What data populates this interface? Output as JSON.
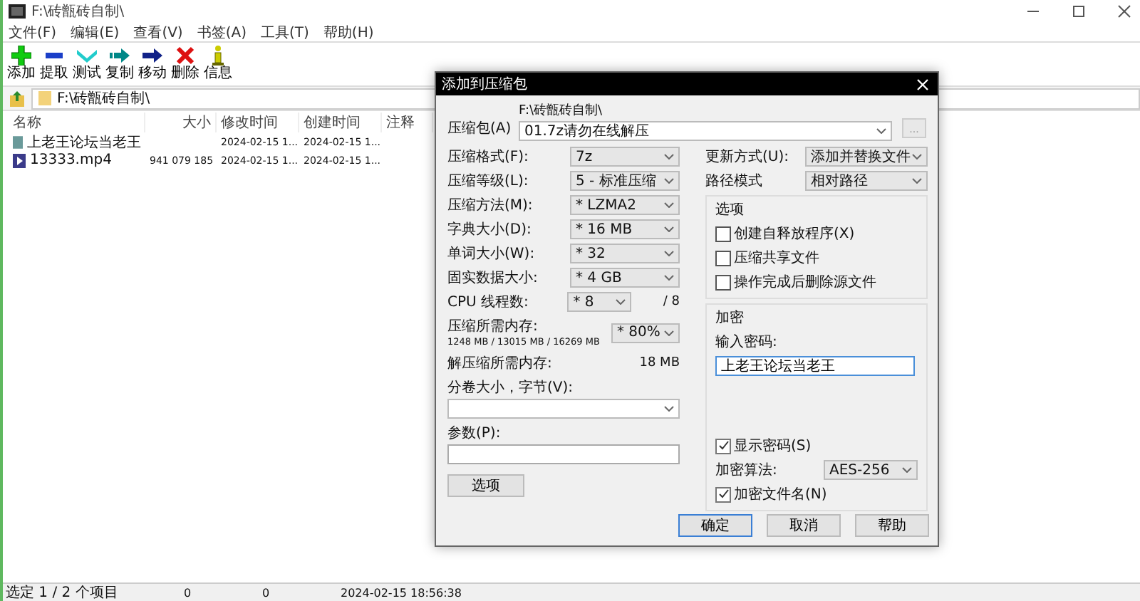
{
  "window": {
    "title": "F:\\砖甑砖自制\\"
  },
  "menu": [
    "文件(F)",
    "编辑(E)",
    "查看(V)",
    "书签(A)",
    "工具(T)",
    "帮助(H)"
  ],
  "toolbar": [
    {
      "label": "添加",
      "kind": "add"
    },
    {
      "label": "提取",
      "kind": "extract"
    },
    {
      "label": "测试",
      "kind": "test"
    },
    {
      "label": "复制",
      "kind": "copy"
    },
    {
      "label": "移动",
      "kind": "move"
    },
    {
      "label": "删除",
      "kind": "delete"
    },
    {
      "label": "信息",
      "kind": "info"
    }
  ],
  "address": {
    "path": "F:\\砖甑砖自制\\"
  },
  "file_list": {
    "columns": [
      "名称",
      "大小",
      "修改时间",
      "创建时间",
      "注释"
    ],
    "rows": [
      {
        "kind": "folder",
        "cells": [
          "上老王论坛当老王",
          "",
          "2024-02-15 1...",
          "2024-02-15 1..."
        ]
      },
      {
        "kind": "video",
        "cells": [
          "13333.mp4",
          "941 079 185",
          "2024-02-15 1...",
          "2024-02-15 1..."
        ]
      }
    ]
  },
  "status_bar": [
    "选定 1 / 2 个项目",
    "0",
    "0",
    "2024-02-15 18:56:38"
  ],
  "dialog": {
    "title": "添加到压缩包",
    "archive": {
      "label": "压缩包(A)",
      "folder": "F:\\砖甑砖自制\\",
      "value": "01.7z请勿在线解压",
      "browse": "..."
    },
    "left": [
      {
        "kind": "select",
        "label": "压缩格式(F):",
        "value": "7z"
      },
      {
        "kind": "select",
        "label": "压缩等级(L):",
        "value": "5 - 标准压缩"
      },
      {
        "kind": "select",
        "label": "压缩方法(M):",
        "value": "* LZMA2"
      },
      {
        "kind": "select",
        "label": "字典大小(D):",
        "value": "* 16 MB"
      },
      {
        "kind": "select",
        "label": "单词大小(W):",
        "value": "* 32"
      },
      {
        "kind": "select",
        "label": "固实数据大小:",
        "value": "* 4 GB"
      },
      {
        "kind": "threads",
        "label": "CPU 线程数:",
        "value": "* 8",
        "suffix": "/ 8"
      },
      {
        "kind": "memory",
        "label": "压缩所需内存:",
        "detail": "1248 MB / 13015 MB / 16269 MB",
        "value": "* 80%"
      },
      {
        "kind": "info",
        "label": "解压缩所需内存:",
        "value": "18 MB"
      },
      {
        "kind": "stacked_select",
        "label": "分卷大小，字节(V):"
      },
      {
        "kind": "stacked_input",
        "label": "参数(P):"
      }
    ],
    "options_button": "选项",
    "update": {
      "label": "更新方式(U):",
      "value": "添加并替换文件"
    },
    "path_mode": {
      "label": "路径模式",
      "value": "相对路径"
    },
    "options": {
      "title": "选项",
      "items": [
        {
          "label": "创建自释放程序(X)",
          "checked": false
        },
        {
          "label": "压缩共享文件",
          "checked": false
        },
        {
          "label": "操作完成后删除源文件",
          "checked": false
        }
      ]
    },
    "encryption": {
      "title": "加密",
      "password_label": "输入密码:",
      "password": "上老王论坛当老王",
      "items": [
        {
          "kind": "checkbox",
          "label": "显示密码(S)",
          "checked": true
        },
        {
          "kind": "select",
          "label": "加密算法:",
          "value": "AES-256"
        },
        {
          "kind": "checkbox",
          "label": "加密文件名(N)",
          "checked": true
        }
      ]
    },
    "buttons": [
      {
        "label": "确定",
        "default": true
      },
      {
        "label": "取消",
        "default": false
      },
      {
        "label": "帮助",
        "default": false
      }
    ]
  }
}
